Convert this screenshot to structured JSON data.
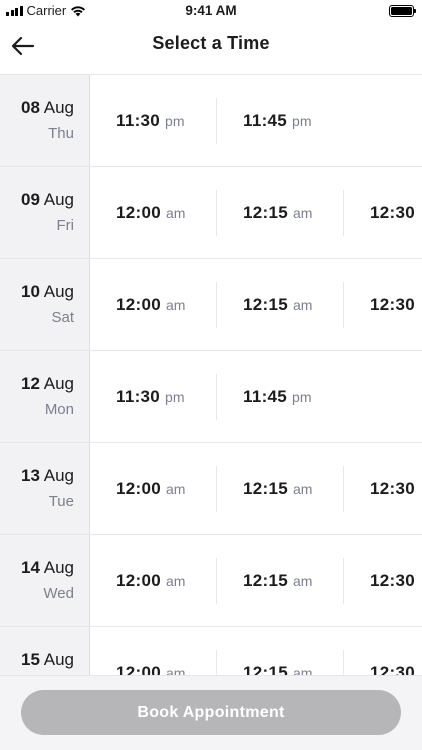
{
  "status_bar": {
    "carrier": "Carrier",
    "time": "9:41 AM"
  },
  "header": {
    "title": "Select a Time"
  },
  "schedule": [
    {
      "day": "08",
      "month": "Aug",
      "weekday": "Thu",
      "slots": [
        {
          "time": "11:30",
          "period": "pm"
        },
        {
          "time": "11:45",
          "period": "pm"
        }
      ]
    },
    {
      "day": "09",
      "month": "Aug",
      "weekday": "Fri",
      "slots": [
        {
          "time": "12:00",
          "period": "am"
        },
        {
          "time": "12:15",
          "period": "am"
        },
        {
          "time": "12:30",
          "period": ""
        }
      ]
    },
    {
      "day": "10",
      "month": "Aug",
      "weekday": "Sat",
      "slots": [
        {
          "time": "12:00",
          "period": "am"
        },
        {
          "time": "12:15",
          "period": "am"
        },
        {
          "time": "12:30",
          "period": ""
        }
      ]
    },
    {
      "day": "12",
      "month": "Aug",
      "weekday": "Mon",
      "slots": [
        {
          "time": "11:30",
          "period": "pm"
        },
        {
          "time": "11:45",
          "period": "pm"
        }
      ]
    },
    {
      "day": "13",
      "month": "Aug",
      "weekday": "Tue",
      "slots": [
        {
          "time": "12:00",
          "period": "am"
        },
        {
          "time": "12:15",
          "period": "am"
        },
        {
          "time": "12:30",
          "period": ""
        }
      ]
    },
    {
      "day": "14",
      "month": "Aug",
      "weekday": "Wed",
      "slots": [
        {
          "time": "12:00",
          "period": "am"
        },
        {
          "time": "12:15",
          "period": "am"
        },
        {
          "time": "12:30",
          "period": ""
        }
      ]
    },
    {
      "day": "15",
      "month": "Aug",
      "weekday": "",
      "slots": [
        {
          "time": "12:00",
          "period": "am"
        },
        {
          "time": "12:15",
          "period": "am"
        },
        {
          "time": "12:30",
          "period": ""
        }
      ]
    }
  ],
  "footer": {
    "book_label": "Book Appointment"
  },
  "colors": {
    "accent_disabled": "#b6b6b9",
    "date_column_bg": "#f2f2f4",
    "muted_text": "#7a8090"
  },
  "icons": {
    "back": "arrow-left-icon",
    "wifi": "wifi-icon",
    "signal": "signal-icon",
    "battery": "battery-icon"
  }
}
